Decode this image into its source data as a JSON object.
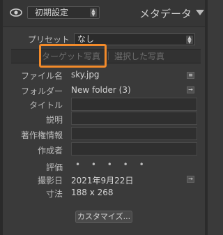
{
  "header": {
    "preset_value": "初期設定",
    "panel_title": "メタデータ"
  },
  "preset_row": {
    "label": "プリセット",
    "value": "なし"
  },
  "tabs": {
    "target": "ターゲット写真",
    "selected": "選択した写真"
  },
  "fields": {
    "filename": {
      "label": "ファイル名",
      "value": "sky.jpg"
    },
    "folder": {
      "label": "フォルダー",
      "value": "New folder (3)"
    },
    "title": {
      "label": "タイトル",
      "value": ""
    },
    "caption": {
      "label": "説明",
      "value": ""
    },
    "copyright": {
      "label": "著作権情報",
      "value": ""
    },
    "creator": {
      "label": "作成者",
      "value": ""
    },
    "rating": {
      "label": "評価",
      "value": "• • • • •"
    },
    "capture_date": {
      "label": "撮影日",
      "value": "2021年9月22日"
    },
    "dimensions": {
      "label": "寸法",
      "value": "188 x 268"
    }
  },
  "customize_label": "カスタマイズ...",
  "colors": {
    "highlight": "#f28a2a",
    "background": "#3a3a3a"
  }
}
